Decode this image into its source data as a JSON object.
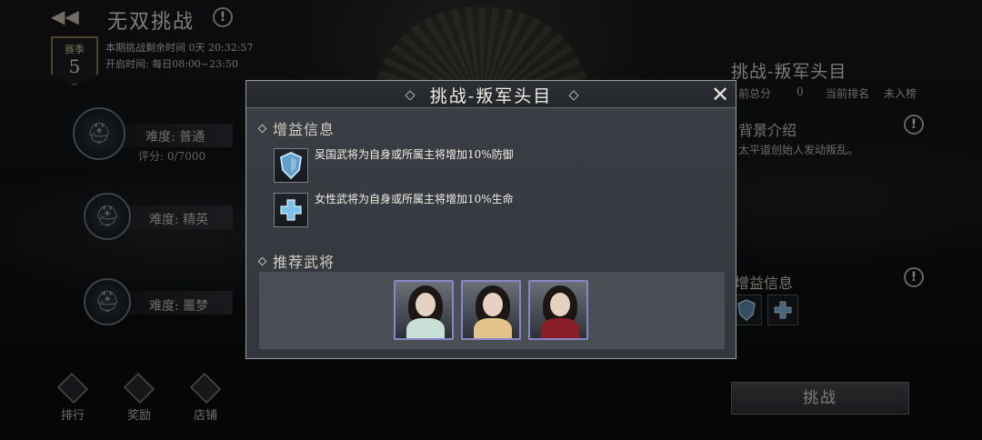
{
  "header": {
    "title": "无双挑战",
    "back_icon": "back-arrow-icon"
  },
  "season": {
    "label": "赛季",
    "number": "5"
  },
  "meta": {
    "remaining": "本期挑战剩余时间 0天 20:32:57",
    "open_time": "开启时间: 每日08:00~23:50"
  },
  "difficulties": [
    {
      "label": "难度: 普通",
      "score": "评分: 0/7000"
    },
    {
      "label": "难度: 精英"
    },
    {
      "label": "难度: 噩梦"
    }
  ],
  "bottom_nav": [
    {
      "label": "排行",
      "icon": "ranking-icon"
    },
    {
      "label": "奖励",
      "icon": "gift-icon"
    },
    {
      "label": "店铺",
      "icon": "shop-icon"
    }
  ],
  "right_panel": {
    "title": "挑战-叛军头目",
    "score_label": "前总分",
    "score_value": "0",
    "rank_label": "当前排名",
    "rank_value": "未入榜",
    "background_head": "背景介绍",
    "background_text": "太平道创始人发动叛乱。",
    "buff_head": "增益信息",
    "challenge_button": "挑战"
  },
  "modal": {
    "title": "挑战-叛军头目",
    "buff_section": "增益信息",
    "buffs": [
      {
        "text": "吴国武将为自身或所属主将增加10%防御",
        "icon": "shield-icon"
      },
      {
        "text": "女性武将为自身或所属主将增加10%生命",
        "icon": "cross-icon"
      }
    ],
    "recommend_section": "推荐武将",
    "heroes": [
      {
        "icon": "hero-portrait-icon",
        "color": "#c9e0d6"
      },
      {
        "icon": "hero-portrait-icon",
        "color": "#e3c48a"
      },
      {
        "icon": "hero-portrait-icon",
        "color": "#8a1f28"
      }
    ],
    "close_icon": "close-icon"
  },
  "colors": {
    "accent_gold": "#8d7a52",
    "hero_border": "#8a86c6"
  }
}
